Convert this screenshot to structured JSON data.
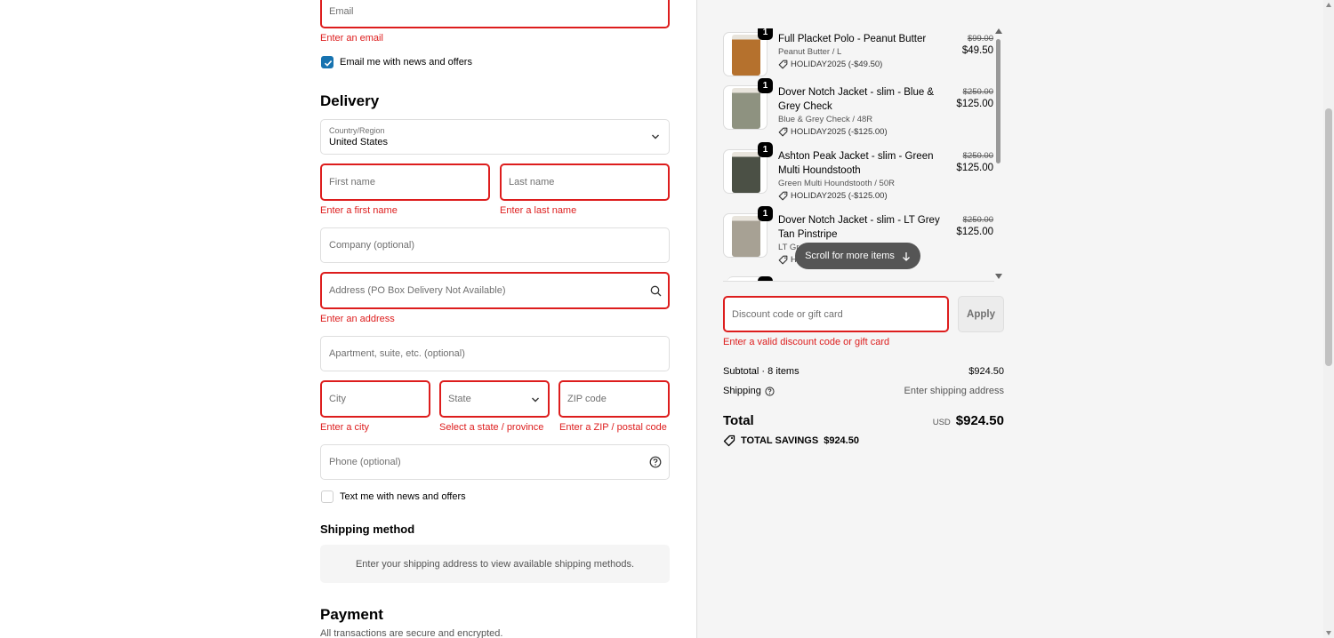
{
  "contact": {
    "email_placeholder": "Email",
    "email_error": "Enter an email",
    "news_label": "Email me with news and offers",
    "news_checked": true
  },
  "delivery": {
    "heading": "Delivery",
    "country_label": "Country/Region",
    "country_value": "United States",
    "first_name_placeholder": "First name",
    "first_name_error": "Enter a first name",
    "last_name_placeholder": "Last name",
    "last_name_error": "Enter a last name",
    "company_placeholder": "Company (optional)",
    "address_placeholder": "Address (PO Box Delivery Not Available)",
    "address_error": "Enter an address",
    "apartment_placeholder": "Apartment, suite, etc. (optional)",
    "city_placeholder": "City",
    "city_error": "Enter a city",
    "state_placeholder": "State",
    "state_error": "Select a state / province",
    "zip_placeholder": "ZIP code",
    "zip_error": "Enter a ZIP / postal code",
    "phone_placeholder": "Phone (optional)",
    "text_label": "Text me with news and offers",
    "text_checked": false
  },
  "shipping_method": {
    "heading": "Shipping method",
    "message": "Enter your shipping address to view available shipping methods."
  },
  "payment": {
    "heading": "Payment",
    "subtext": "All transactions are secure and encrypted."
  },
  "cart": {
    "items": [
      {
        "qty": "1",
        "name": "Full Placket Polo - Peanut Butter",
        "variant": "Peanut Butter / L",
        "discount": "HOLIDAY2025 (-$49.50)",
        "old_price": "$99.00",
        "price": "$49.50",
        "image_color": "#b5712d"
      },
      {
        "qty": "1",
        "name": "Dover Notch Jacket - slim - Blue & Grey Check",
        "variant": "Blue & Grey Check / 48R",
        "discount": "HOLIDAY2025 (-$125.00)",
        "old_price": "$250.00",
        "price": "$125.00",
        "image_color": "#8e9280"
      },
      {
        "qty": "1",
        "name": "Ashton Peak Jacket - slim - Green Multi Houndstooth",
        "variant": "Green Multi Houndstooth / 50R",
        "discount": "HOLIDAY2025 (-$125.00)",
        "old_price": "$250.00",
        "price": "$125.00",
        "image_color": "#4b5045"
      },
      {
        "qty": "1",
        "name": "Dover Notch Jacket - slim - LT Grey Tan Pinstripe",
        "variant": "LT Gr",
        "discount": "H",
        "old_price": "$250.00",
        "price": "$125.00",
        "image_color": "#a7a194"
      }
    ],
    "scroll_hint": "Scroll for more items",
    "discount_placeholder": "Discount code or gift card",
    "discount_error": "Enter a valid discount code or gift card",
    "apply_label": "Apply",
    "subtotal_label": "Subtotal · 8 items",
    "subtotal_value": "$924.50",
    "shipping_label": "Shipping",
    "shipping_value": "Enter shipping address",
    "total_label": "Total",
    "currency": "USD",
    "total_value": "$924.50",
    "savings_label": "TOTAL SAVINGS",
    "savings_value": "$924.50"
  },
  "colors": {
    "error": "#dd1d1d",
    "accent": "#1773b0",
    "sidebar_bg": "#f5f5f5"
  }
}
